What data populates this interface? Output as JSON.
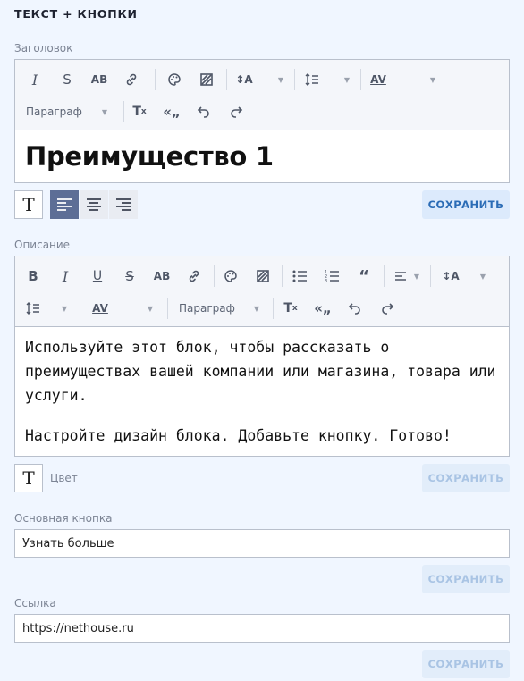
{
  "section_title": "ТЕКСТ + КНОПКИ",
  "heading": {
    "label": "Заголовок",
    "paragraph_dropdown": "Параграф",
    "content": "Преимущество 1",
    "save_label": "СОХРАНИТЬ"
  },
  "description": {
    "label": "Описание",
    "paragraph_dropdown": "Параграф",
    "paragraph1": "Используйте этот блок, чтобы рассказать о преимуществах вашей компании или магазина, товара или услуги.",
    "paragraph2": "Настройте дизайн блока. Добавьте кнопку. Готово!",
    "color_label": "Цвет",
    "save_label": "СОХРАНИТЬ"
  },
  "main_button": {
    "label": "Основная кнопка",
    "value": "Узнать больше",
    "save_label": "СОХРАНИТЬ"
  },
  "link": {
    "label": "Ссылка",
    "value": "https://nethouse.ru",
    "save_label": "СОХРАНИТЬ"
  },
  "colors": {
    "accent": "#2b6cb6",
    "active_align": "#5d6e96",
    "background": "#f0f6ff"
  }
}
